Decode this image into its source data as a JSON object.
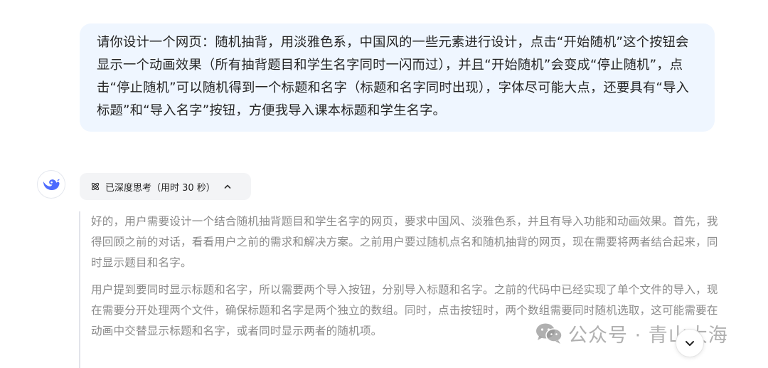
{
  "user_message": {
    "text": "请你设计一个网页：随机抽背，用淡雅色系，中国风的一些元素进行设计，点击“开始随机”这个按钮会显示一个动画效果（所有抽背题目和学生名字同时一闪而过），并且“开始随机”会变成“停止随机”，点击“停止随机”可以随机得到一个标题和名字（标题和名字同时出现），字体尽可能大点，还要具有“导入标题”和“导入名字”按钮，方便我导入课本标题和学生名字。"
  },
  "assistant": {
    "avatar_icon": "whale-logo-icon",
    "accent_color": "#4d6bfe",
    "thinking_toggle": {
      "label": "已深度思考（用时 30 秒）",
      "icon": "atom-icon",
      "chevron": "chevron-up-icon"
    },
    "reasoning_paragraphs": [
      "好的，用户需要设计一个结合随机抽背题目和学生名字的网页，要求中国风、淡雅色系，并且有导入功能和动画效果。首先，我得回顾之前的对话，看看用户之前的需求和解决方案。之前用户要过随机点名和随机抽背的网页，现在需要将两者结合起来，同时显示题目和名字。",
      "用户提到要同时显示标题和名字，所以需要两个导入按钮，分别导入标题和名字。之前的代码中已经实现了单个文件的导入，现在需要分开处理两个文件，确保标题和名字是两个独立的数组。同时，点击按钮时，两个数组需要同时随机选取，这可能需要在动画中交替显示标题和名字，或者同时显示两者的随机项。"
    ]
  },
  "watermark": {
    "text": "公众号 · 青山大海",
    "icon": "wechat-icon"
  },
  "scroll_button": {
    "icon": "chevron-down-icon"
  }
}
